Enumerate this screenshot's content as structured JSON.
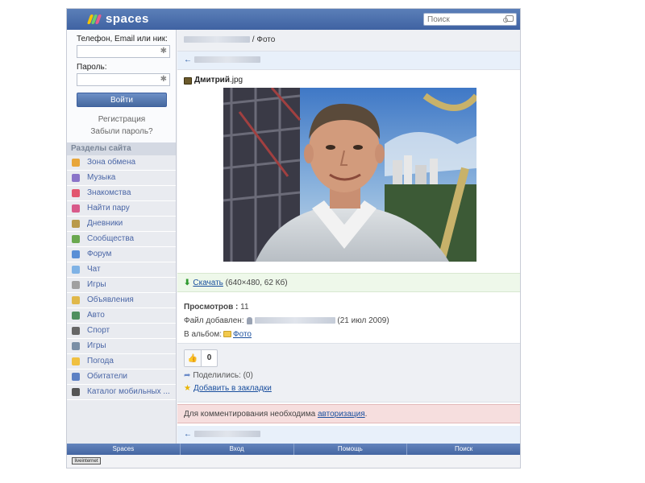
{
  "header": {
    "logo_text": "spaces",
    "search_placeholder": "Поиск"
  },
  "login": {
    "username_label": "Телефон, Email или ник:",
    "password_label": "Пароль:",
    "submit_label": "Войти",
    "register_link": "Регистрация",
    "forgot_link": "Забыли пароль?"
  },
  "sidebar": {
    "section_title": "Разделы сайта",
    "items": [
      {
        "label": "Зона обмена",
        "icon": "grid-icon",
        "color": "#e8a63a"
      },
      {
        "label": "Музыка",
        "icon": "music-note-icon",
        "color": "#8a74c9"
      },
      {
        "label": "Знакомства",
        "icon": "heart-icon",
        "color": "#e2566f"
      },
      {
        "label": "Найти пару",
        "icon": "hearts-icon",
        "color": "#d85a8a"
      },
      {
        "label": "Дневники",
        "icon": "pencil-icon",
        "color": "#b99a4a"
      },
      {
        "label": "Сообщества",
        "icon": "people-icon",
        "color": "#6aa84f"
      },
      {
        "label": "Форум",
        "icon": "forum-icon",
        "color": "#5a8fd6"
      },
      {
        "label": "Чат",
        "icon": "chat-bubble-icon",
        "color": "#7fb2e5"
      },
      {
        "label": "Игры",
        "icon": "joystick-icon",
        "color": "#a0a0a0"
      },
      {
        "label": "Объявления",
        "icon": "ads-icon",
        "color": "#e0b84a"
      },
      {
        "label": "Авто",
        "icon": "car-icon",
        "color": "#4f8f5f"
      },
      {
        "label": "Спорт",
        "icon": "ball-icon",
        "color": "#666666"
      },
      {
        "label": "Игры",
        "icon": "game-icon",
        "color": "#7a8fa6"
      },
      {
        "label": "Погода",
        "icon": "cloud-sun-icon",
        "color": "#f0c040"
      },
      {
        "label": "Обитатели",
        "icon": "user-icon",
        "color": "#5b80c4"
      },
      {
        "label": "Каталог мобильных ...",
        "icon": "phone-icon",
        "color": "#555555"
      }
    ]
  },
  "content": {
    "breadcrumb_suffix": "/ Фото",
    "back_arrow": "←",
    "file_name_bold": "Дмитрий",
    "file_ext": ".jpg",
    "download_label": "Скачать",
    "download_meta": "(640×480, 62 Кб)",
    "views_label": "Просмотров :",
    "views_count": "11",
    "added_label": "Файл добавлен:",
    "added_date": "(21 июл 2009)",
    "album_label": "В альбом:",
    "album_name": "Фото",
    "like_count": "0",
    "share_text": "Поделились: (0)",
    "bookmark_label": "Добавить в закладки",
    "auth_prefix": "Для комментирования необходима",
    "auth_link": "авторизация",
    "auth_suffix": "."
  },
  "footer": {
    "items": [
      "Spaces",
      "Вход",
      "Помощь",
      "Поиск"
    ],
    "counter_text": "liveinternet"
  },
  "colors": {
    "header": "#4a6ca8",
    "download_bg": "#eef8ea",
    "warning_bg": "#f6dede",
    "link": "#1a4f9e"
  }
}
